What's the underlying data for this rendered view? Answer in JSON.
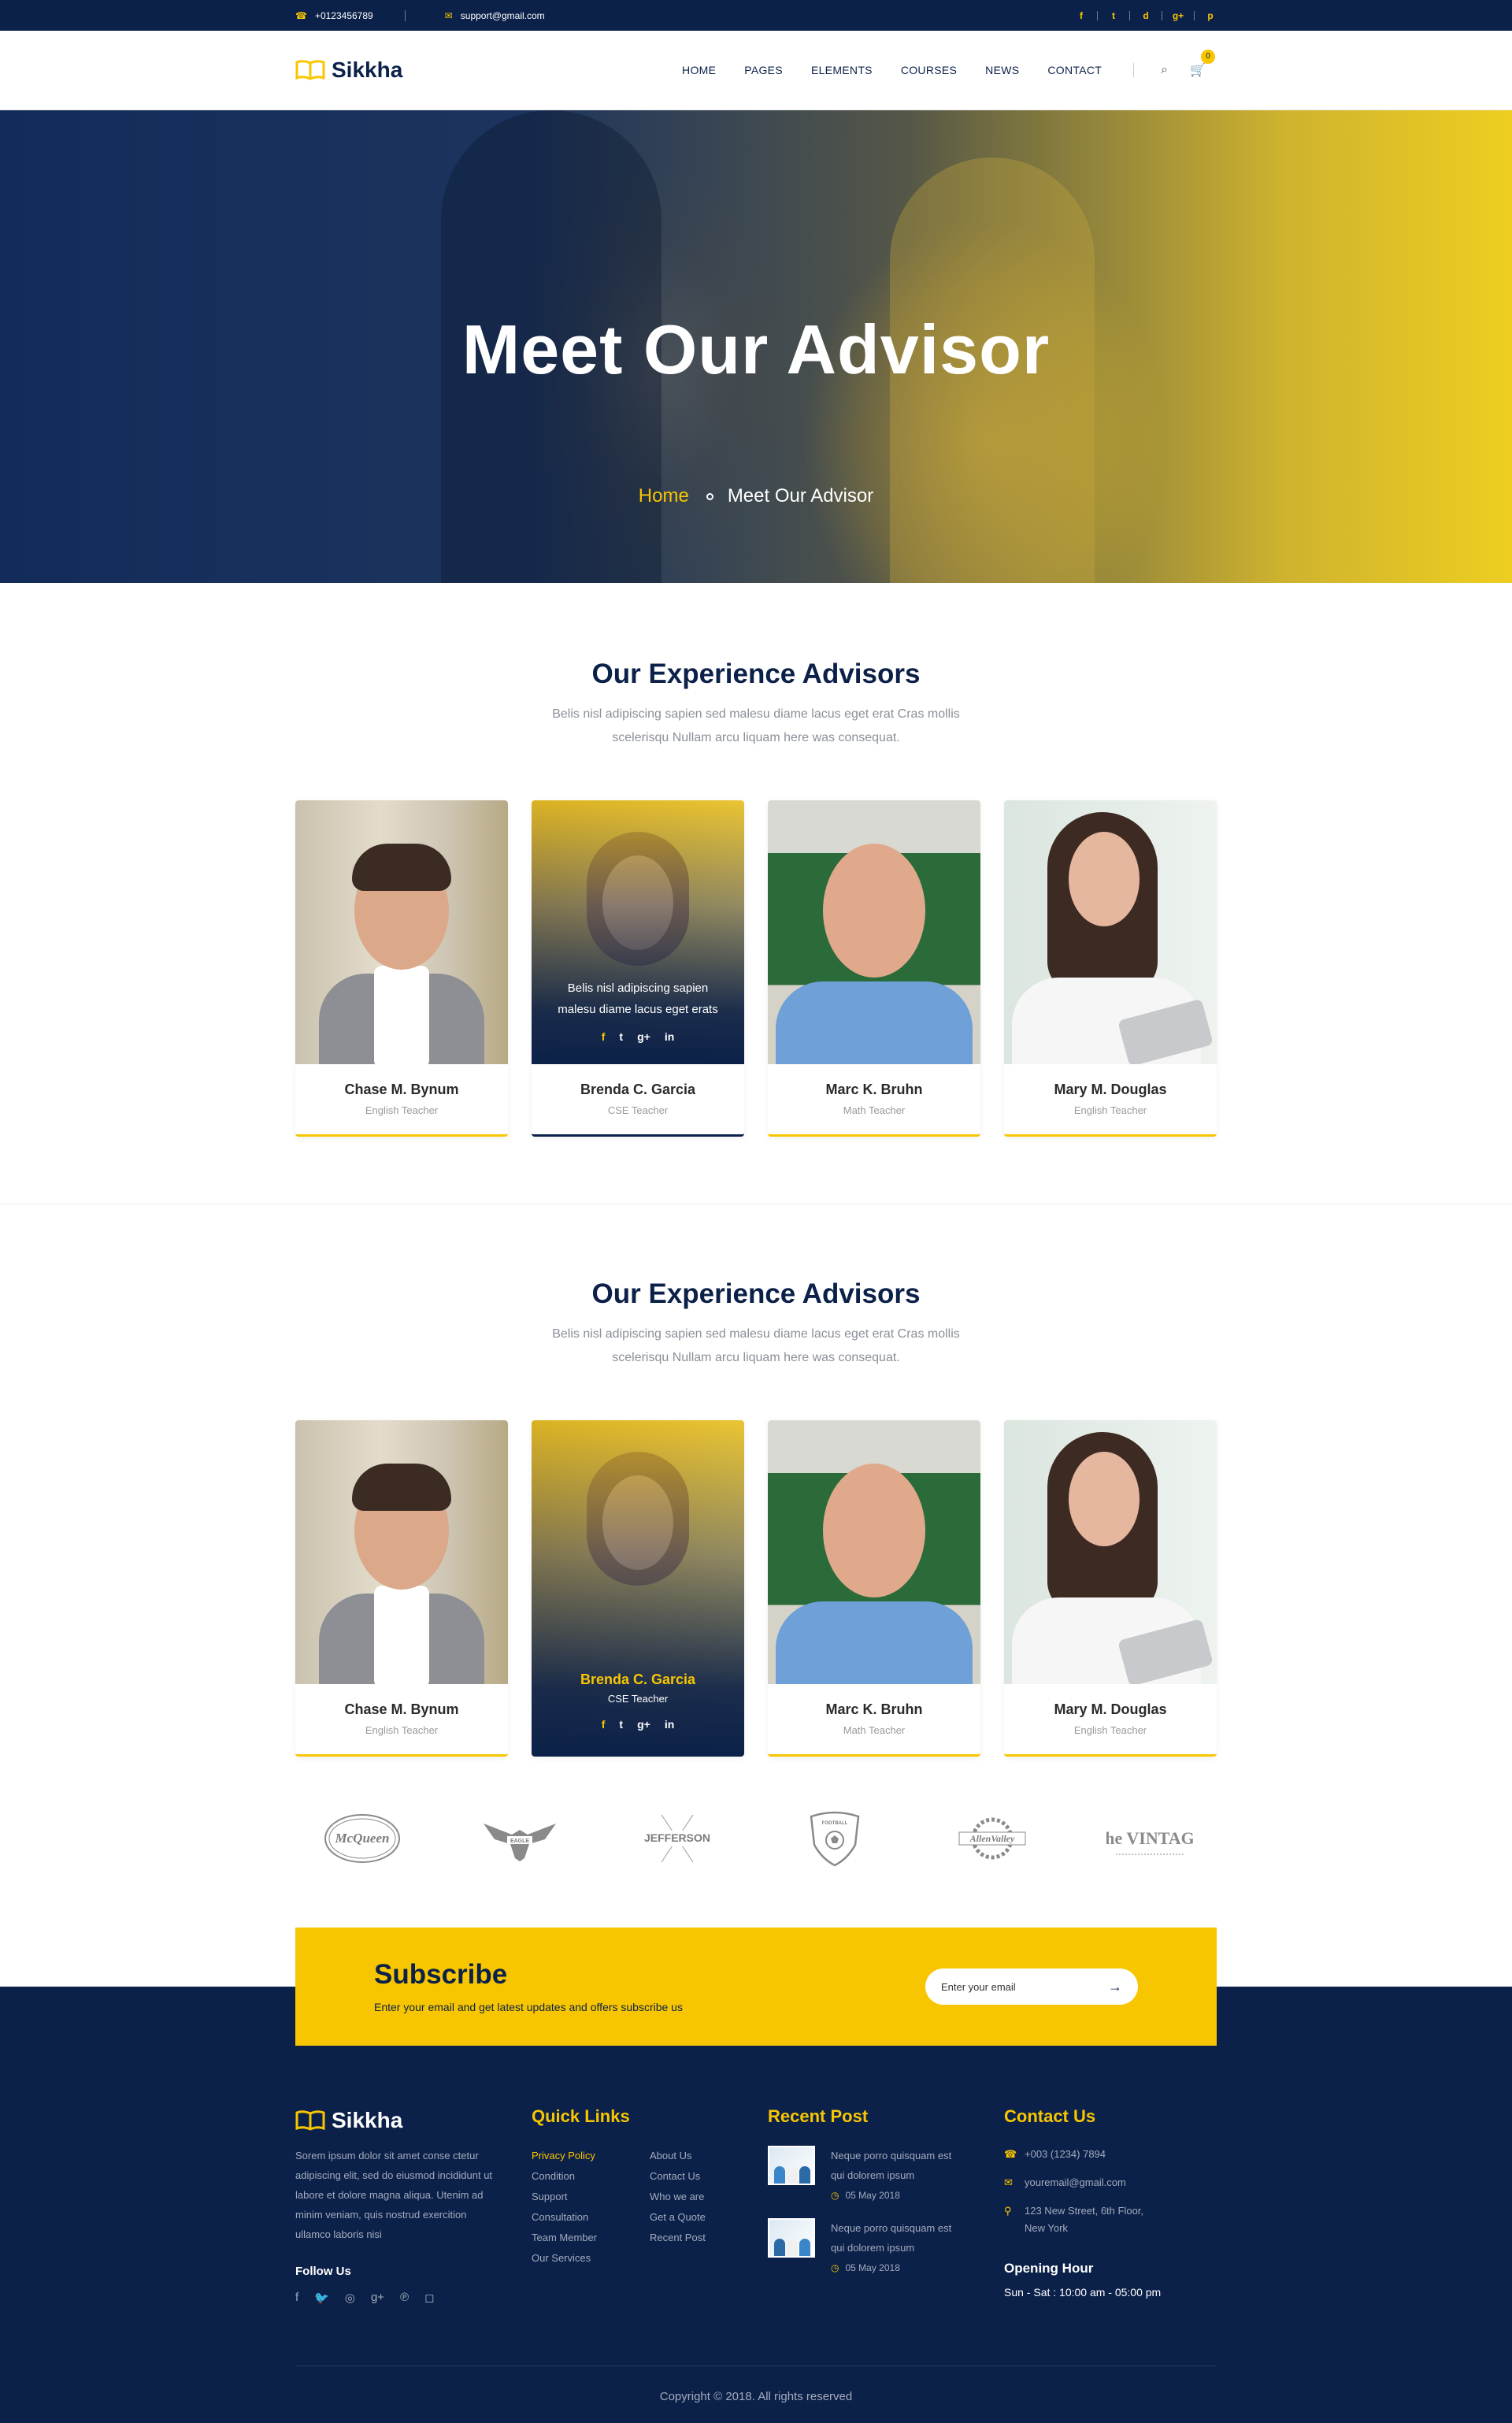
{
  "topbar": {
    "phone": "+0123456789",
    "email": "support@gmail.com",
    "social": [
      "f",
      "t",
      "d",
      "g+",
      "p"
    ]
  },
  "header": {
    "brand": "Sikkha",
    "nav": [
      "HOME",
      "PAGES",
      "ELEMENTS",
      "COURSES",
      "NEWS",
      "CONTACT"
    ],
    "cart_count": "0"
  },
  "hero": {
    "title": "Meet Our Advisor",
    "breadcrumb_home": "Home",
    "breadcrumb_current": "Meet Our Advisor"
  },
  "section1": {
    "title": "Our Experience Advisors",
    "subtitle": "Belis nisl adipiscing sapien sed malesu diame lacus eget erat Cras mollis scelerisqu Nullam arcu liquam here was consequat."
  },
  "section2": {
    "title": "Our Experience Advisors",
    "subtitle": "Belis nisl adipiscing sapien sed malesu diame lacus eget erat Cras mollis scelerisqu Nullam arcu liquam here was consequat."
  },
  "advisors": [
    {
      "name": "Chase M. Bynum",
      "role": "English Teacher"
    },
    {
      "name": "Brenda C. Garcia",
      "role": "CSE Teacher",
      "hover_text": "Belis nisl adipiscing sapien malesu diame lacus eget erats"
    },
    {
      "name": "Marc K. Bruhn",
      "role": "Math Teacher"
    },
    {
      "name": "Mary M. Douglas",
      "role": "English Teacher"
    }
  ],
  "card_social": [
    "f",
    "t",
    "g+",
    "in"
  ],
  "brands": [
    "McQueen",
    "EAGLE",
    "JEFFERSON",
    "FOOTBALL",
    "AllenValley",
    "The VINTAGE"
  ],
  "subscribe": {
    "title": "Subscribe",
    "text": "Enter  your email and get latest updates and offers subscribe us",
    "placeholder": "Enter your email"
  },
  "footer": {
    "brand": "Sikkha",
    "about": "Sorem ipsum dolor sit amet conse ctetur adipiscing elit, sed do eiusmod  incididunt ut labore et dolore magna aliqua. Utenim ad minim veniam, quis nostrud exercition ullamco laboris nisi",
    "follow_label": "Follow Us",
    "quick_title": "Quick Links",
    "links_left": [
      "Privacy Policy",
      "Condition",
      "Support",
      "Consultation",
      "Team Member",
      "Our Services"
    ],
    "links_right": [
      "About Us",
      "Contact Us",
      "Who we are",
      "Get a Quote",
      "Recent Post"
    ],
    "recent_title": "Recent Post",
    "posts": [
      {
        "text": "Neque porro quisquam est qui dolorem ipsum",
        "date": "05 May 2018"
      },
      {
        "text": "Neque porro quisquam est qui dolorem ipsum",
        "date": "05 May 2018"
      }
    ],
    "contact_title": "Contact Us",
    "phone": "+003 (1234) 7894",
    "email": "youremail@gmail.com",
    "address": "123 New Street, 6th Floor, New York",
    "hours_title": "Opening Hour",
    "hours": "Sun - Sat : 10:00 am - 05:00 pm",
    "copyright": "Copyright © 2018. All rights reserved"
  },
  "colors": {
    "navy": "#0c2149",
    "accent": "#f8c600"
  }
}
